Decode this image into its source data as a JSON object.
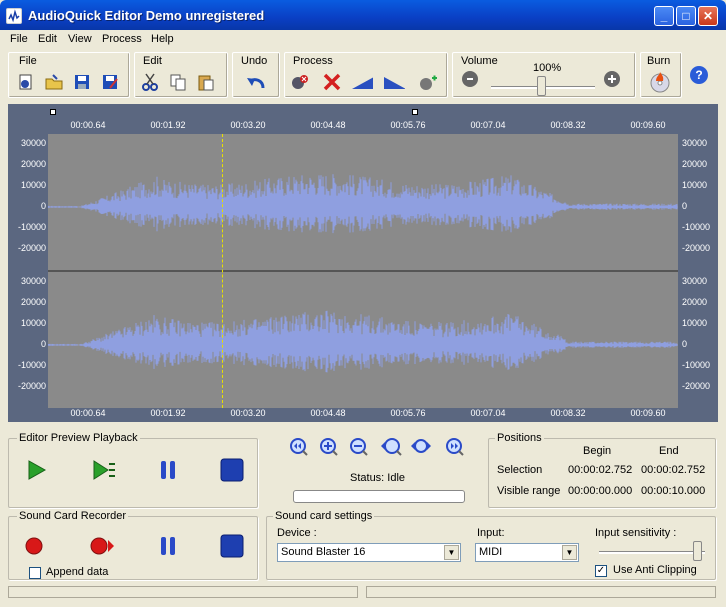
{
  "window": {
    "title": "AudioQuick Editor Demo unregistered"
  },
  "menu": [
    "File",
    "Edit",
    "View",
    "Process",
    "Help"
  ],
  "toolbar": {
    "file_label": "File",
    "edit_label": "Edit",
    "undo_label": "Undo",
    "process_label": "Process",
    "volume_label": "Volume",
    "volume_value": "100%",
    "burn_label": "Burn"
  },
  "waveform": {
    "time_ticks": [
      "00:00.64",
      "00:01.92",
      "00:03.20",
      "00:04.48",
      "00:05.76",
      "00:07.04",
      "00:08.32",
      "00:09.60"
    ],
    "amp_ticks": [
      "30000",
      "20000",
      "10000",
      "0",
      "-10000",
      "-20000"
    ]
  },
  "playback": {
    "title": "Editor Preview Playback"
  },
  "zoom": {
    "status": "Status: Idle"
  },
  "positions": {
    "title": "Positions",
    "col_begin": "Begin",
    "col_end": "End",
    "selection_label": "Selection",
    "selection_begin": "00:00:02.752",
    "selection_end": "00:00:02.752",
    "visible_label": "Visible range",
    "visible_begin": "00:00:00.000",
    "visible_end": "00:00:10.000"
  },
  "recorder": {
    "title": "Sound Card Recorder",
    "append_label": "Append data",
    "append_checked": false
  },
  "settings": {
    "title": "Sound card settings",
    "device_label": "Device :",
    "device_value": "Sound Blaster 16",
    "input_label": "Input:",
    "input_value": "MIDI",
    "sensitivity_label": "Input sensitivity :",
    "anticlip_label": "Use Anti Clipping",
    "anticlip_checked": true
  }
}
